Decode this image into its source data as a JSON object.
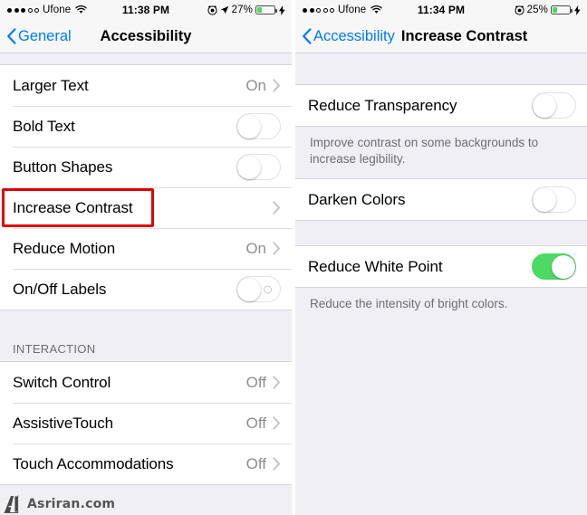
{
  "left": {
    "status_bar": {
      "signal_dots_filled": 3,
      "signal_dots_total": 5,
      "carrier": "Ufone",
      "wifi_icon": "wifi-icon",
      "time": "11:38 PM",
      "alarm_icon": "alarm-clock-icon",
      "location_icon": "location-arrow-icon",
      "battery_percent": "27%",
      "battery_level": 27,
      "charging_icon": "lightning-bolt-icon"
    },
    "nav": {
      "back_icon": "chevron-left-icon",
      "back_label": "General",
      "title": "Accessibility"
    },
    "rows": [
      {
        "label": "Larger Text",
        "value": "On",
        "control": "chevron",
        "chevron_icon": "chevron-right-icon"
      },
      {
        "label": "Bold Text",
        "value": "",
        "control": "toggle-off"
      },
      {
        "label": "Button Shapes",
        "value": "",
        "control": "toggle-off"
      },
      {
        "label": "Increase Contrast",
        "value": "",
        "control": "chevron",
        "chevron_icon": "chevron-right-icon",
        "highlighted": true
      },
      {
        "label": "Reduce Motion",
        "value": "On",
        "control": "chevron",
        "chevron_icon": "chevron-right-icon"
      },
      {
        "label": "On/Off Labels",
        "value": "",
        "control": "toggle-off-labeled"
      }
    ],
    "section_header": "INTERACTION",
    "rows2": [
      {
        "label": "Switch Control",
        "value": "Off",
        "control": "chevron",
        "chevron_icon": "chevron-right-icon"
      },
      {
        "label": "AssistiveTouch",
        "value": "Off",
        "control": "chevron",
        "chevron_icon": "chevron-right-icon"
      },
      {
        "label": "Touch Accommodations",
        "value": "Off",
        "control": "chevron",
        "chevron_icon": "chevron-right-icon"
      }
    ]
  },
  "right": {
    "status_bar": {
      "signal_dots_filled": 2,
      "signal_dots_total": 5,
      "carrier": "Ufone",
      "wifi_icon": "wifi-icon",
      "time": "11:34 PM",
      "alarm_icon": "alarm-clock-icon",
      "battery_percent": "25%",
      "battery_level": 25,
      "charging_icon": "lightning-bolt-icon"
    },
    "nav": {
      "back_icon": "chevron-left-icon",
      "back_label": "Accessibility",
      "title": "Increase Contrast"
    },
    "rows": [
      {
        "label": "Reduce Transparency",
        "control": "toggle-off"
      }
    ],
    "note1": "Improve contrast on some backgrounds to increase legibility.",
    "rows2": [
      {
        "label": "Darken Colors",
        "control": "toggle-off"
      }
    ],
    "rows3": [
      {
        "label": "Reduce White Point",
        "control": "toggle-on"
      }
    ],
    "note2": "Reduce the intensity of bright colors."
  },
  "watermark": {
    "text": "Asriran.com",
    "mark": "ai-logo-icon"
  },
  "colors": {
    "accent_blue": "#007AFF",
    "toggle_on_green": "#4CD964",
    "group_background": "#EFEFF4",
    "row_background": "#FFFFFF",
    "secondary_text": "#8E8E93",
    "highlight_red": "#E00000"
  }
}
